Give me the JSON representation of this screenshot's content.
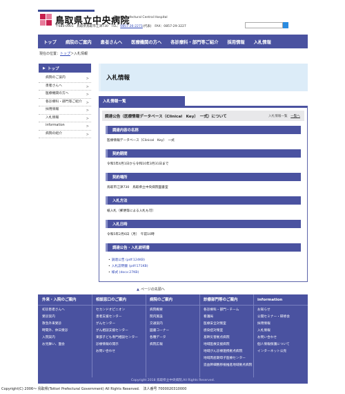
{
  "header": {
    "site_name": "鳥取県立中央病院",
    "site_name_en": "Tottori Prefectural Central Hospital",
    "address_prefix": "〒680-0901　鳥取県鳥取市江津730　TEL：",
    "tel": "0857-26-2271",
    "address_suffix": "(代表)　FAX：0857-29-3227"
  },
  "nav": {
    "items": [
      "トップ",
      "病院のご案内",
      "患者さんへ",
      "医療機関の方へ",
      "各診療科・部門等ご紹介",
      "採用情報",
      "入札情報"
    ]
  },
  "breadcrumb": {
    "prefix": "現在の位置：",
    "top": "トップ",
    "sep": "＞",
    "current": "入札情報"
  },
  "sidebar": {
    "head": "トップ",
    "items": [
      {
        "label": "病院のご案内"
      },
      {
        "label": "患者さんへ"
      },
      {
        "label": "医療機関の方へ"
      },
      {
        "label": "各診療科・部門等ご紹介"
      },
      {
        "label": "採用情報"
      },
      {
        "label": "入札情報"
      },
      {
        "label": "information"
      },
      {
        "label": "病院の紹介"
      }
    ]
  },
  "main": {
    "page_title": "入札情報",
    "list_tab": "入札情報一覧",
    "notice_title": "調達公告（医療情報データベース（Clinical　Key）　一式）について",
    "notice_img_alt": "入札情報一覧",
    "notice_list_link": "一覧へ",
    "sections": [
      {
        "title": "調達内容の名称",
        "text": "医療情報データベース（Clinical　Key）　一式"
      },
      {
        "title": "契約期間",
        "text": "令和5年4月1日から令和10年3月31日まで"
      },
      {
        "title": "契約場所",
        "text": "鳥取市江津730　鳥取県立中央病院図書室"
      },
      {
        "title": "入札方法",
        "text": "紙入札（郵便等による入札も可）"
      },
      {
        "title": "入札日時",
        "text": "令和5年2月6日（月）　午前10時"
      },
      {
        "title": "調達公告・入札説明書",
        "text": ""
      }
    ],
    "documents": [
      "調達公告 (pdf:124KB)",
      "入札説明書 (pdf:171KB)",
      "様式 (docx:27KB)"
    ]
  },
  "to_top": "ページの先頭へ",
  "footer": {
    "columns": [
      {
        "head": "外来・入院のご案内",
        "items": [
          "初診患者さんへ",
          "受診案内",
          "救急外来受診",
          "時間外、休日受診",
          "入院案内",
          "お見舞い、面会"
        ]
      },
      {
        "head": "相談窓口のご案内",
        "items": [
          "セカンドオピニオン",
          "患者支援センター",
          "がんセンター",
          "がん相談支援センター",
          "東部子ども専門相談センター",
          "診療情報の開示",
          "お問い合わせ"
        ]
      },
      {
        "head": "病院のご案内",
        "items": [
          "病院概要",
          "院内施設",
          "交通案内",
          "図書コーナー",
          "各種データ",
          "病院広報"
        ]
      },
      {
        "head": "診療部門等のご案内",
        "items": [
          "各診療科・部門・チーム",
          "看護局",
          "医療安全対策室",
          "感染症対策室",
          "基幹災害拠点病院",
          "地域医療支援病院",
          "地域がん診療連携拠点病院",
          "地域周産期母子医療センター",
          "造血幹細胞移植推進地域拠点病院"
        ]
      },
      {
        "head": "information",
        "items": [
          "お知らせ",
          "公開セミナー・研修会",
          "採用情報",
          "入札情報",
          "お問い合わせ",
          "個人情報保護について",
          "インターネット公売"
        ]
      }
    ],
    "copyright1": "Copyright 2018 鳥取県立中央病院,All Rights Reserved.",
    "copyright2": "Copyright(C) 2006〜 鳥取県(Tottori Prefectural Government) All Rights Reserved.　法人番号 7000020310000"
  },
  "colors": {
    "brand_navy": "#4a52a0",
    "title_bg": "#dcecf8",
    "link_blue": "#2a43b7"
  }
}
